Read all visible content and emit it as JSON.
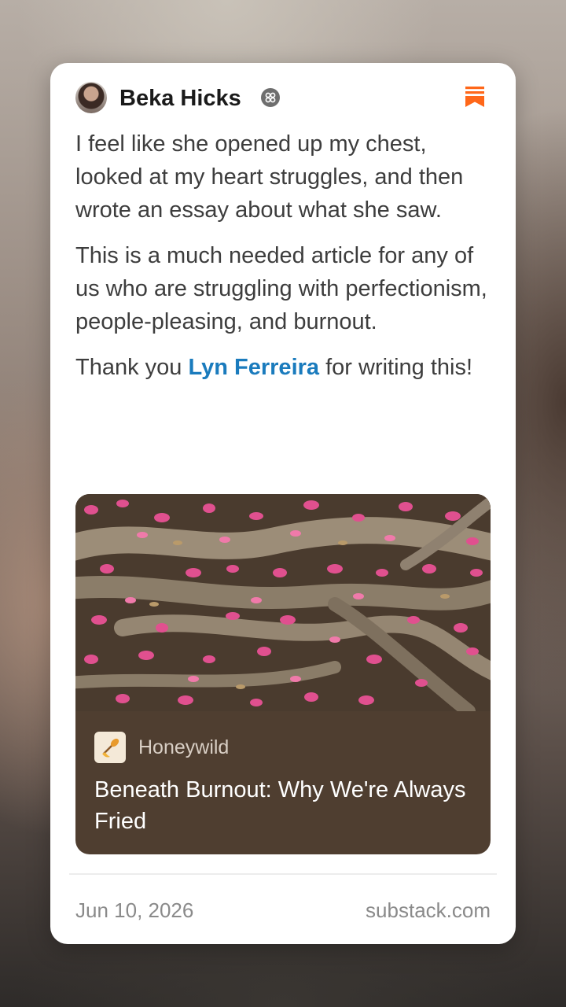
{
  "author": {
    "name": "Beka Hicks"
  },
  "note": {
    "paragraph1": "I feel like she opened up my chest, looked at my heart struggles, and then wrote an essay about what she saw.",
    "paragraph2": "This is a much needed article for any of us who are struggling with perfectionism, people-pleasing, and burnout.",
    "paragraph3_before": "Thank you ",
    "mention": "Lyn Ferreira",
    "paragraph3_after": " for writing this!"
  },
  "embed": {
    "publication": "Honeywild",
    "title": "Beneath Burnout: Why We're Always Fried"
  },
  "footer": {
    "date": "Jun 10, 2026",
    "domain": "substack.com"
  },
  "icons": {
    "verified_badge": "verified-badge-icon",
    "bookmark": "substack-logo-icon",
    "publication": "honey-dipper-icon"
  },
  "colors": {
    "accent": "#ff6719",
    "mention": "#1a7bbd",
    "embed_bg": "#4f3e30"
  }
}
